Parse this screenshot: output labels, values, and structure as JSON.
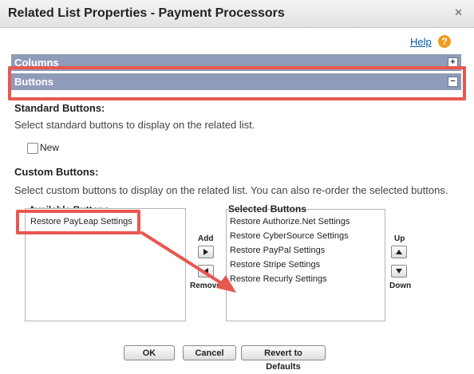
{
  "dialog": {
    "title": "Related List Properties - Payment Processors",
    "close_icon": "close-icon"
  },
  "help": {
    "link_label": "Help",
    "icon": "?"
  },
  "sections": {
    "columns_label": "Columns",
    "columns_toggle": "+",
    "buttons_label": "Buttons",
    "buttons_toggle": "−"
  },
  "standard_buttons": {
    "heading": "Standard Buttons:",
    "description": "Select standard buttons to display on the related list.",
    "options": [
      {
        "label": "New",
        "checked": false
      }
    ]
  },
  "custom_buttons": {
    "heading": "Custom Buttons:",
    "description": "Select custom buttons to display on the related list. You can also re-order the selected buttons.",
    "available_caption": "Available Buttons",
    "available_items": [
      "Restore PayLeap Settings"
    ],
    "selected_caption": "Selected Buttons",
    "selected_items": [
      "Restore Authorize.Net Settings",
      "Restore CyberSource Settings",
      "Restore PayPal Settings",
      "Restore Stripe Settings",
      "Restore Recurly Settings"
    ],
    "add_label": "Add",
    "remove_label": "Remove",
    "up_label": "Up",
    "down_label": "Down"
  },
  "footer": {
    "ok_label": "OK",
    "cancel_label": "Cancel",
    "revert_label": "Revert to Defaults"
  },
  "colors": {
    "section_bar": "#8f9bb8",
    "annotation": "#e8574f",
    "link": "#015ba7"
  }
}
